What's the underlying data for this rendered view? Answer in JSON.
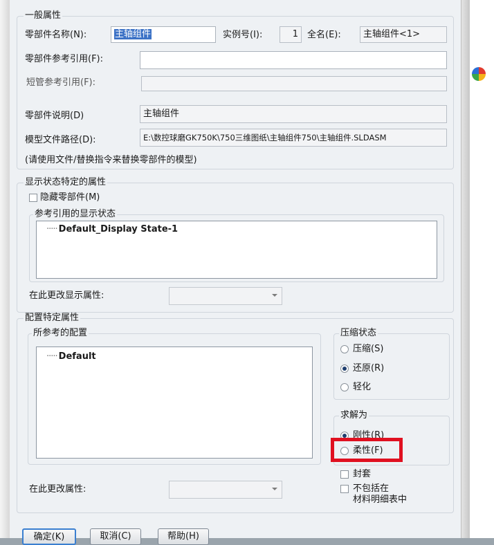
{
  "general": {
    "title": "一般属性",
    "component_name_label": "零部件名称(N):",
    "component_name_value": "主轴组件",
    "instance_label": "实例号(I):",
    "instance_value": "1",
    "fullname_label": "全名(E):",
    "fullname_value": "主轴组件<1>",
    "reference_label": "零部件参考引用(F):",
    "reference_value": "",
    "short_ref_label": "短管参考引用(F):",
    "short_ref_value": "",
    "description_label": "零部件说明(D)",
    "description_value": "主轴组件",
    "path_label": "模型文件路径(D):",
    "path_value": "E:\\数控球磨GK750K\\750三维图纸\\主轴组件750\\主轴组件.SLDASM",
    "note": "(请使用文件/替换指令来替换零部件的模型)"
  },
  "display": {
    "title": "显示状态特定的属性",
    "hide_label": "隐藏零部件(M)",
    "ref_states_title": "参考引用的显示状态",
    "states": [
      "Default_Display State-1"
    ],
    "change_label": "在此更改显示属性:"
  },
  "config": {
    "title": "配置特定属性",
    "referenced_title": "所参考的配置",
    "configs": [
      "Default"
    ],
    "change_label": "在此更改属性:",
    "suppression": {
      "title": "压缩状态",
      "options": [
        "压缩(S)",
        "还原(R)",
        "轻化"
      ],
      "selected": "还原(R)"
    },
    "solve_as": {
      "title": "求解为",
      "options": [
        "刚性(R)",
        "柔性(F)"
      ],
      "selected": "刚性(R)"
    },
    "envelope_label": "封套",
    "exclude_bom_label_line1": "不包括在",
    "exclude_bom_label_line2": "材料明细表中"
  },
  "buttons": {
    "ok": "确定(K)",
    "cancel": "取消(C)",
    "help": "帮助(H)"
  },
  "colors": {
    "highlight": "#e01020",
    "selection": "#3c72c6"
  }
}
